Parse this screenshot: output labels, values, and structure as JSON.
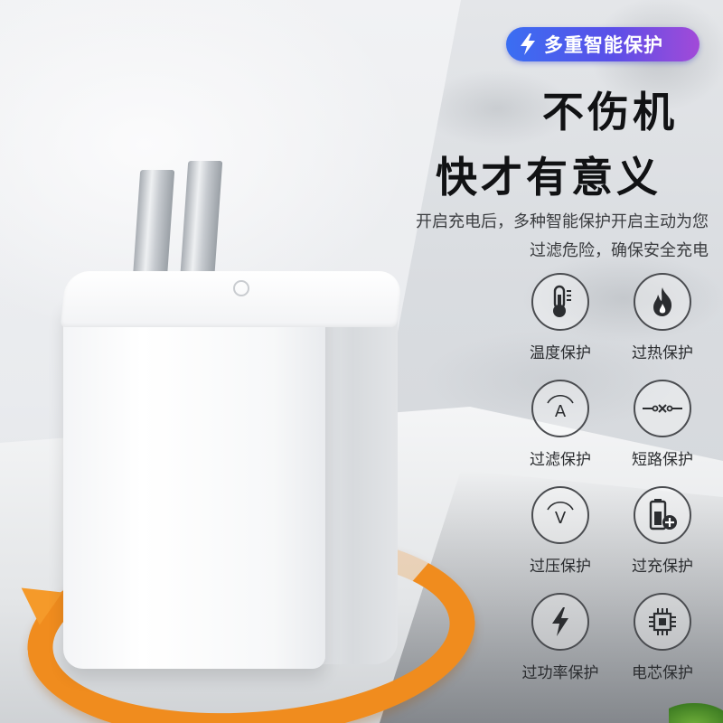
{
  "badge": {
    "text": "多重智能保护",
    "icon": "lightning-bolt-icon"
  },
  "headline": {
    "line1": "不伤机",
    "line2": "快才有意义"
  },
  "description": {
    "line1": "开启充电后，多种智能保护开启主动为您",
    "line2": "过滤危险，确保安全充电"
  },
  "features": [
    {
      "label": "温度保护",
      "icon": "thermometer-icon"
    },
    {
      "label": "过热保护",
      "icon": "flame-icon"
    },
    {
      "label": "过滤保护",
      "icon": "ampere-gauge-icon"
    },
    {
      "label": "短路保护",
      "icon": "short-circuit-icon"
    },
    {
      "label": "过压保护",
      "icon": "voltage-gauge-icon"
    },
    {
      "label": "过充保护",
      "icon": "battery-plus-icon"
    },
    {
      "label": "过功率保护",
      "icon": "lightning-bolt-icon"
    },
    {
      "label": "电芯保护",
      "icon": "chip-icon"
    }
  ],
  "colors": {
    "badge_gradient_start": "#3a6ef2",
    "badge_gradient_end": "#a24ad8",
    "ring_orange": "#f08c1e",
    "heading_text": "#111214"
  }
}
